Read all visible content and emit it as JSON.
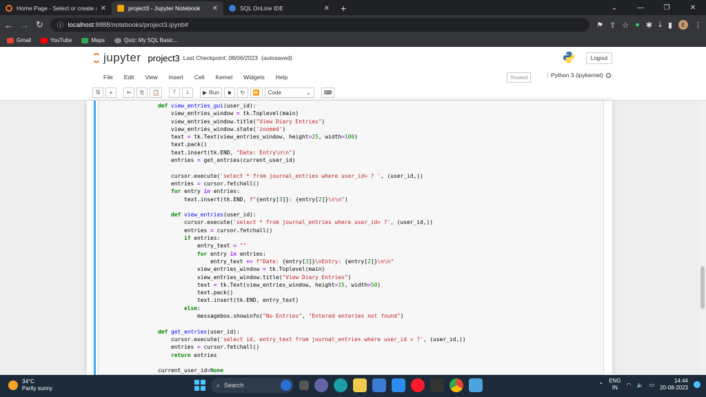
{
  "browser": {
    "tabs": [
      {
        "title": "Home Page - Select or create a n",
        "close": "✕",
        "color": "#f37726"
      },
      {
        "title": "project3 - Jupyter Notebook",
        "close": "✕",
        "color": "#f0a500"
      },
      {
        "title": "SQL OnLine IDE",
        "close": "✕",
        "color": "#3b7bd6"
      }
    ],
    "new_tab": "+",
    "url_host": "localhost",
    "url_rest": ":8888/notebooks/project3.ipynb#",
    "bookmarks": [
      {
        "label": "Gmail",
        "color": "#ea4335"
      },
      {
        "label": "YouTube",
        "color": "#ff0000"
      },
      {
        "label": "Maps",
        "color": "#34a853"
      },
      {
        "label": "Quiz: My SQL Basic...",
        "color": "#888888"
      }
    ],
    "profile_initial": "E"
  },
  "jupyter": {
    "logo_text": "jupyter",
    "notebook_name": "project3",
    "checkpoint": "Last Checkpoint: 08/06/2023",
    "autosaved": "(autosaved)",
    "logout": "Logout",
    "menu": [
      "File",
      "Edit",
      "View",
      "Insert",
      "Cell",
      "Kernel",
      "Widgets",
      "Help"
    ],
    "trusted": "Trusted",
    "kernel": "Python 3 (ipykernel)",
    "run_label": "Run",
    "cell_type": "Code"
  },
  "taskbar": {
    "temp": "34°C",
    "weather": "Partly sunny",
    "search": "Search",
    "lang1": "ENG",
    "lang2": "IN",
    "time": "14:44",
    "date": "20-08-2023"
  }
}
